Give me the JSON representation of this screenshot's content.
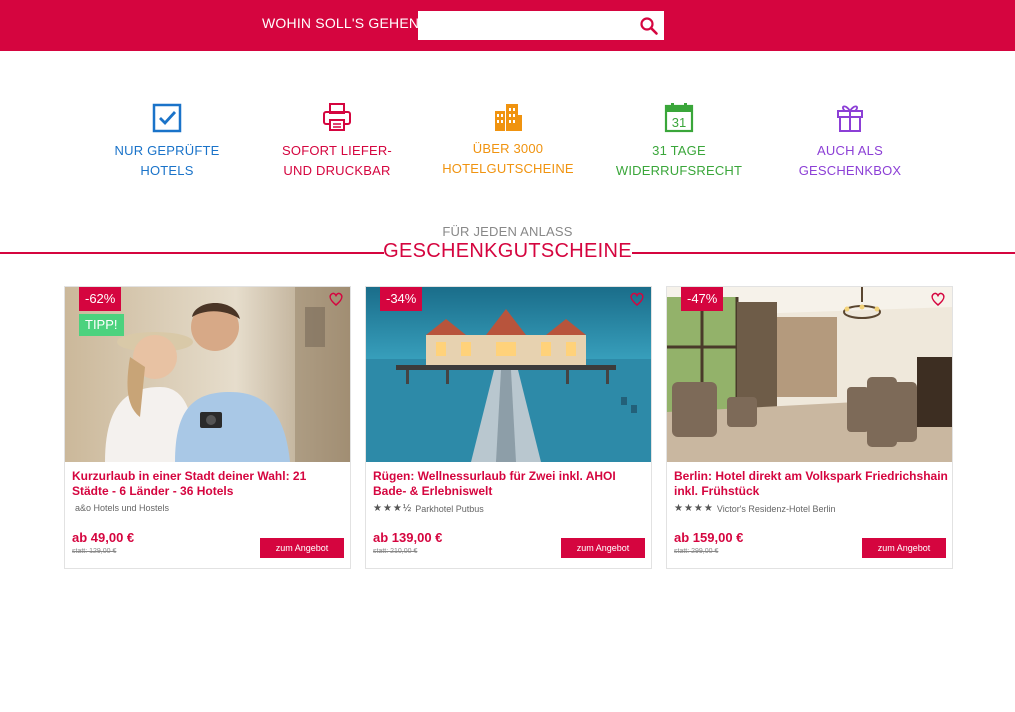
{
  "header": {
    "search_label": "WOHIN SOLL'S GEHEN?",
    "search_value": "",
    "search_placeholder": "",
    "brand_color": "#d5053f",
    "search_icon": "search-icon"
  },
  "features": [
    {
      "line1": "NUR GEPRÜFTE",
      "line2": "HOTELS",
      "color": "#1a73c9",
      "icon": "checkbox-icon"
    },
    {
      "line1": "SOFORT LIEFER-",
      "line2": "UND DRUCKBAR",
      "color": "#d5053f",
      "icon": "printer-icon"
    },
    {
      "line1": "ÜBER 3000",
      "line2": "HOTELGUTSCHEINE",
      "color": "#f0930f",
      "icon": "buildings-icon"
    },
    {
      "line1": "31 TAGE",
      "line2": "WIDERRUFSRECHT",
      "color": "#3aa63a",
      "icon": "calendar-icon",
      "calendar_number": "31"
    },
    {
      "line1": "AUCH ALS",
      "line2": "GESCHENKBOX",
      "color": "#8c3fd6",
      "icon": "gift-icon"
    }
  ],
  "section": {
    "subtitle": "FÜR JEDEN ANLASS",
    "title": "GESCHENKGUTSCHEINE"
  },
  "cards": [
    {
      "discount": "-62%",
      "tipp": "TIPP!",
      "title": "Kurzurlaub in einer Stadt deiner Wahl: 21 Städte - 6 Länder - 36 Hotels",
      "hotel": "a&o Hotels und Hostels",
      "stars": "",
      "price": "ab 49,00 €",
      "old_price": "statt: 129,00 €",
      "button": "zum Angebot",
      "image": "couple-city-photo"
    },
    {
      "discount": "-34%",
      "title": "Rügen: Wellnessurlaub für Zwei inkl. AHOI Bade- & Erlebniswelt",
      "hotel": "Parkhotel Putbus",
      "stars": "★★★½",
      "price": "ab 139,00 €",
      "old_price": "statt: 210,00 €",
      "button": "zum Angebot",
      "image": "pier-night-photo"
    },
    {
      "discount": "-47%",
      "title": "Berlin: Hotel direkt am Volkspark Friedrichshain inkl. Frühstück",
      "hotel": "Victor's Residenz-Hotel Berlin",
      "stars": "★★★★",
      "price": "ab 159,00 €",
      "old_price": "statt: 299,00 €",
      "button": "zum Angebot",
      "image": "hotel-lounge-photo"
    }
  ]
}
